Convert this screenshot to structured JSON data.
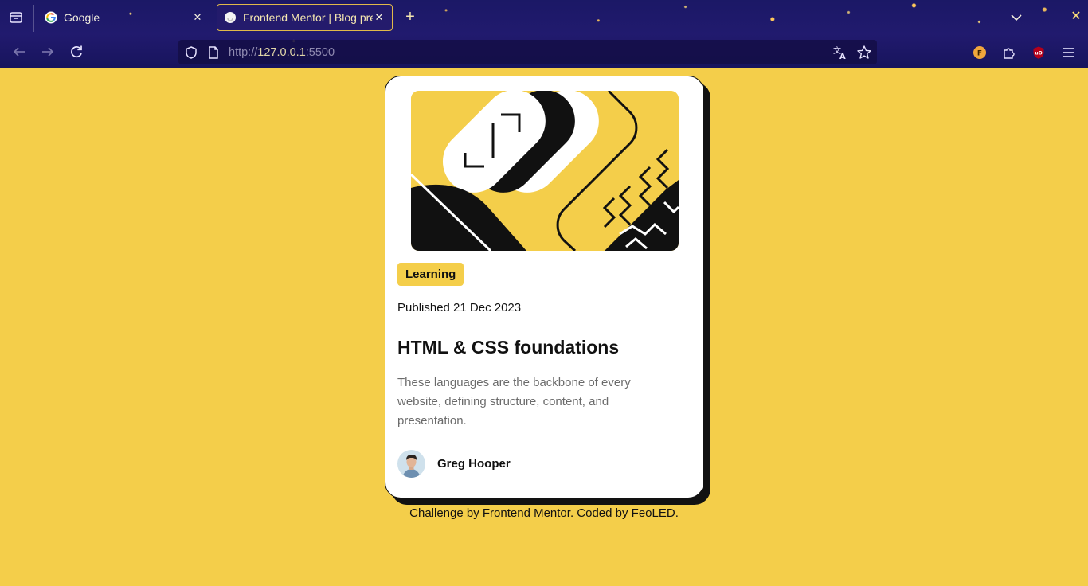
{
  "browser": {
    "tabs": [
      {
        "title": "Google",
        "favicon": "google-icon",
        "active": false
      },
      {
        "title": "Frontend Mentor | Blog preview card",
        "favicon": "page-icon",
        "active": true
      }
    ],
    "url": {
      "scheme": "http://",
      "host": "127.0.0.1",
      "port": ":5500"
    },
    "theme_accent": "#e0b94a"
  },
  "card": {
    "tag": "Learning",
    "published": "Published 21 Dec 2023",
    "title": "HTML & CSS foundations",
    "description": "These languages are the backbone of every website, defining structure, content, and presentation.",
    "author": "Greg Hooper"
  },
  "attribution": {
    "prefix": "Challenge by ",
    "challenge_link": "Frontend Mentor",
    "middle": ". Coded by ",
    "author_link": "FeoLED",
    "suffix": "."
  },
  "colors": {
    "background": "#f4ce4a",
    "card": "#ffffff",
    "ink": "#111111",
    "muted": "#6b6b6b"
  }
}
